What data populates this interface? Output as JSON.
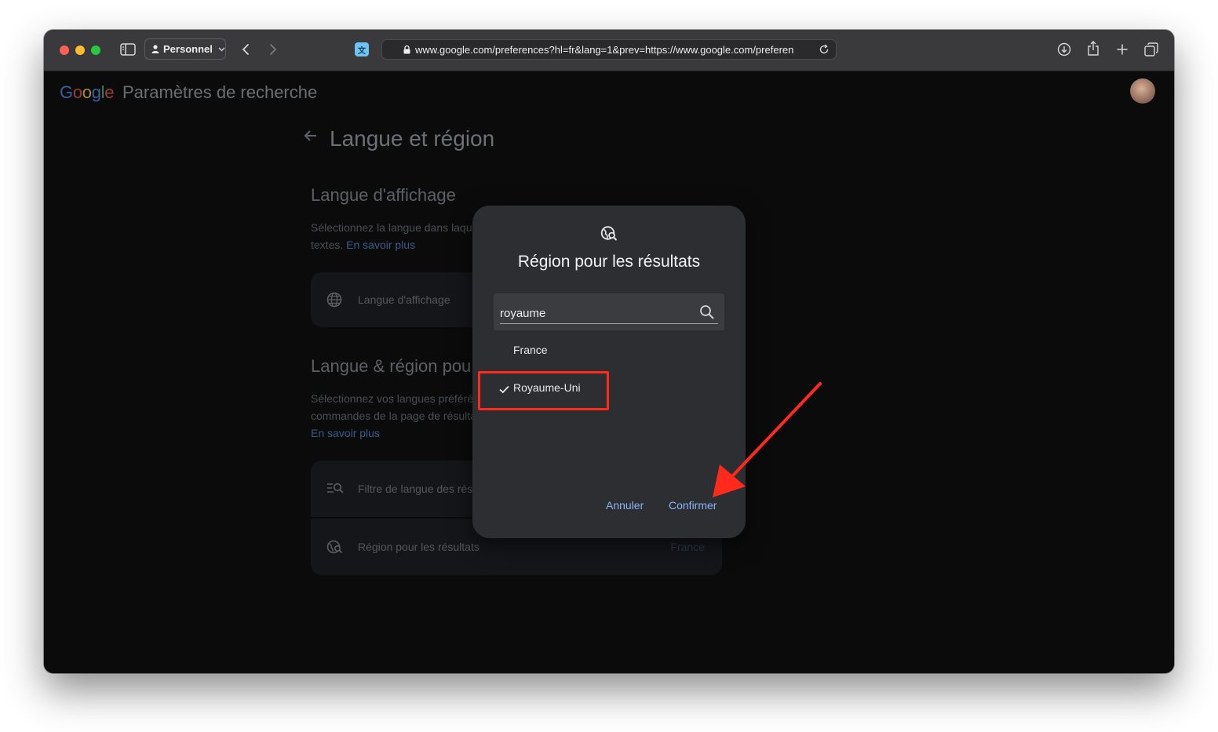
{
  "browser": {
    "profile_label": "Personnel",
    "url": "www.google.com/preferences?hl=fr&lang=1&prev=https://www.google.com/preferen",
    "translate_label": "文"
  },
  "header": {
    "logo": {
      "G": "G",
      "o1": "o",
      "o2": "o",
      "g": "g",
      "l": "l",
      "e": "e"
    },
    "title": "Paramètres de recherche"
  },
  "main": {
    "section_title": "Langue et région",
    "display_language": {
      "heading": "Langue d'affichage",
      "desc_line1": "Sélectionnez la langue dans laqu",
      "desc_line2_prefix": "textes.",
      "learn_more": "En savoir plus",
      "row_label": "Langue d'affichage"
    },
    "search_language": {
      "heading": "Langue & région pou",
      "desc_line1": "Sélectionnez vos langues préféré",
      "desc_line2": "commandes de la page de résulta",
      "learn_more": "En savoir plus",
      "rows": [
        {
          "label": "Filtre de langue des rés"
        },
        {
          "label": "Région pour les résultats",
          "value": "France"
        }
      ]
    }
  },
  "dialog": {
    "title": "Région pour les résultats",
    "search_value": "royaume",
    "options": [
      {
        "label": "France",
        "selected": false
      },
      {
        "label": "Royaume-Uni",
        "selected": true
      }
    ],
    "cancel_label": "Annuler",
    "confirm_label": "Confirmer"
  },
  "colors": {
    "accent_link": "#8ab4f8",
    "annotation_red": "#ff2a1c"
  }
}
